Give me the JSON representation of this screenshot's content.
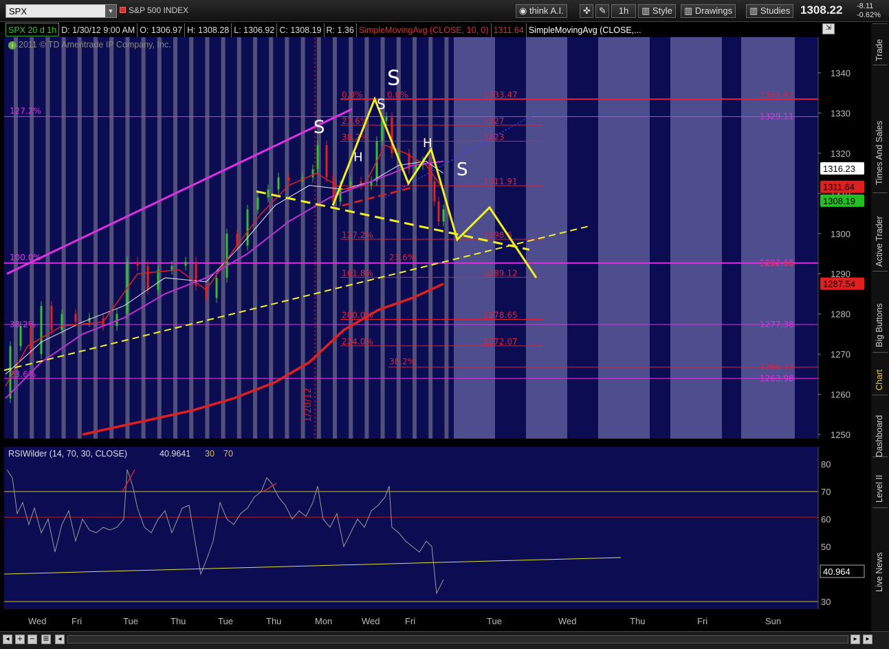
{
  "toolbar": {
    "symbol": "SPX",
    "index_name": "S&P 500 INDEX",
    "think_label": "think A.I.",
    "period_label": "1h",
    "style_label": "Style",
    "drawings_label": "Drawings",
    "studies_label": "Studies",
    "last_price": "1308.22",
    "change": "-8.11",
    "change_pct": "-0.62%"
  },
  "infobar": {
    "symbol_period": "SPX 20 d 1h",
    "date": "D: 1/30/12 9:00 AM",
    "open": "O: 1306.97",
    "high": "H: 1308.28",
    "low": "L: 1306.92",
    "close": "C: 1308.19",
    "range": "R: 1.36",
    "sma1_label": "SimpleMovingAvg (CLOSE, 10, 0)",
    "sma1_value": "1311.64",
    "sma2_label": "SimpleMovingAvg (CLOSE,..."
  },
  "copyright": "2011 © TD Ameritrade IP Company, Inc.",
  "side_tabs": [
    "Trade",
    "Times And Sales",
    "Active Trader",
    "Big Buttons",
    "Chart",
    "Dashboard",
    "Level II",
    "Live News"
  ],
  "active_tab": "Chart",
  "rsi_label": "RSIWilder (14, 70, 30, CLOSE)",
  "rsi_value": "40.9641",
  "rsi_ob": "30",
  "rsi_os": "70",
  "colors": {
    "bg": "#0c0c52",
    "future_band": "#5a5a9a",
    "session_band": "#6e6e8c",
    "fib_red": "#e0203a",
    "fib_magenta": "#e030e0",
    "pattern": "#f0f020",
    "sma_red": "#e02020",
    "sma_magenta": "#c030d0"
  },
  "chart_data": {
    "type": "line",
    "title": "",
    "y_axis": {
      "min": 1250,
      "max": 1340,
      "ticks": [
        1250,
        1260,
        1270,
        1280,
        1290,
        1300,
        1310,
        1320,
        1330,
        1340
      ]
    },
    "x_ticks": [
      "Wed",
      "Fri",
      "Tue",
      "Thu",
      "Tue",
      "Thu",
      "Mon",
      "Wed",
      "Fri",
      "Tue",
      "Wed",
      "Thu",
      "Fri",
      "Sun"
    ],
    "date_marker": "1/20/12",
    "price_labels": [
      {
        "value": 1316.23,
        "label": "1316.23",
        "color": "#ffffff"
      },
      {
        "value": 1311.64,
        "label": "1311.64",
        "color": "#e02020"
      },
      {
        "value": 1308.19,
        "label": "1308.19",
        "color": "#20c020"
      },
      {
        "value": 1287.54,
        "label": "1287.54",
        "color": "#e02020"
      }
    ],
    "fib_levels_red": [
      {
        "pct": "0.0%",
        "value": 1333.47,
        "label": "1333.47"
      },
      {
        "pct": "23.6%",
        "value": 1327,
        "label": "1327"
      },
      {
        "pct": "38.2%",
        "value": 1323,
        "label": "1323"
      },
      {
        "pct": "",
        "value": 1311.91,
        "label": "1311.91"
      },
      {
        "pct": "127.2%",
        "value": 1298.6,
        "label": "1298.6"
      },
      {
        "pct": "161.8%",
        "value": 1289.12,
        "label": "1289.12"
      },
      {
        "pct": "200.0%",
        "value": 1278.65,
        "label": "1278.65"
      },
      {
        "pct": "224.0%",
        "value": 1272.07,
        "label": "1272.07"
      }
    ],
    "fib_levels_magenta": [
      {
        "pct": "127.2%",
        "value": 1329.11,
        "label": "1329.11"
      },
      {
        "pct": "100.0%",
        "value": 1292.66,
        "label": "1292.66"
      },
      {
        "pct": "",
        "value": 1277.38,
        "label": "1277.38"
      },
      {
        "pct": "",
        "value": 1263.98,
        "label": "1263.98"
      }
    ],
    "other_red_labels": [
      {
        "pct": "23.6%",
        "value": 1292.4
      },
      {
        "pct": "38.2%",
        "value": 1266.77,
        "label": "1266.77"
      },
      {
        "pct": "0.0%",
        "value": 1333.47
      }
    ],
    "pattern_labels": [
      "S",
      "H",
      "S",
      "S",
      "H",
      "S"
    ],
    "rsi": {
      "ylim": [
        30,
        80
      ],
      "ticks": [
        30,
        40,
        50,
        60,
        70,
        80
      ],
      "last": "40.964"
    }
  }
}
